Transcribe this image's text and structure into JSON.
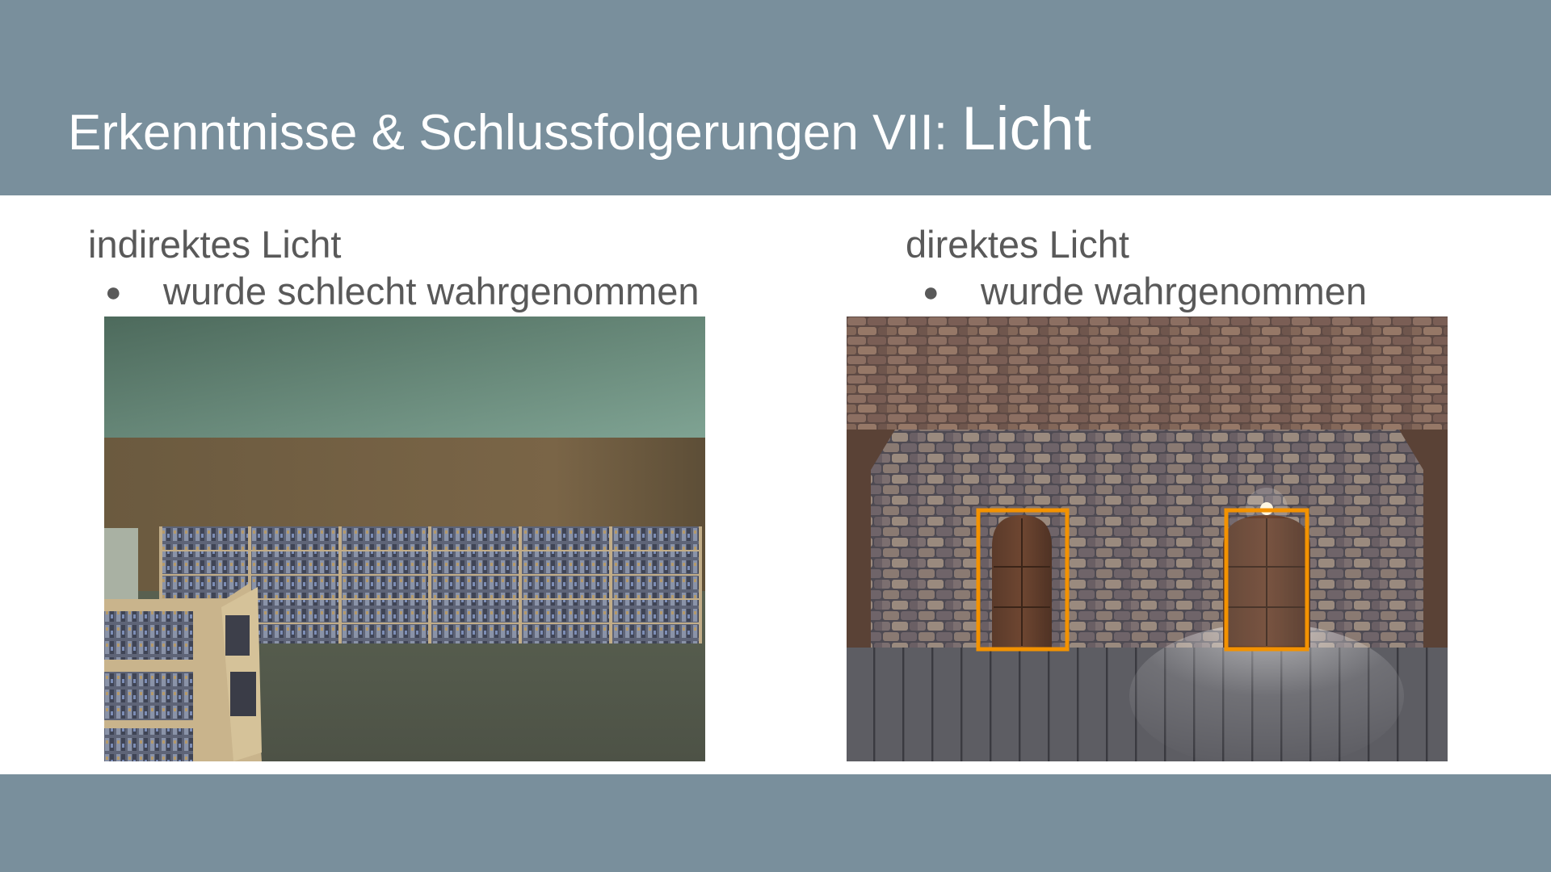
{
  "slide": {
    "title_main": "Erkenntnisse & Schlussfolgerungen VII: ",
    "title_accent": "Licht",
    "colors": {
      "band": "#798f9c",
      "body_text": "#595959",
      "highlight": "#f39200"
    }
  },
  "left": {
    "heading": "indirektes Licht",
    "bullet": "wurde schlecht wahrgenommen",
    "bullet_icon": "bullet-dot",
    "image_subject": "shop-interior-with-media-shelves"
  },
  "right": {
    "heading": "direktes Licht",
    "bullet": "wurde wahrgenommen",
    "bullet_icon": "bullet-dot",
    "image_subject": "brick-room-with-two-highlighted-doors"
  }
}
